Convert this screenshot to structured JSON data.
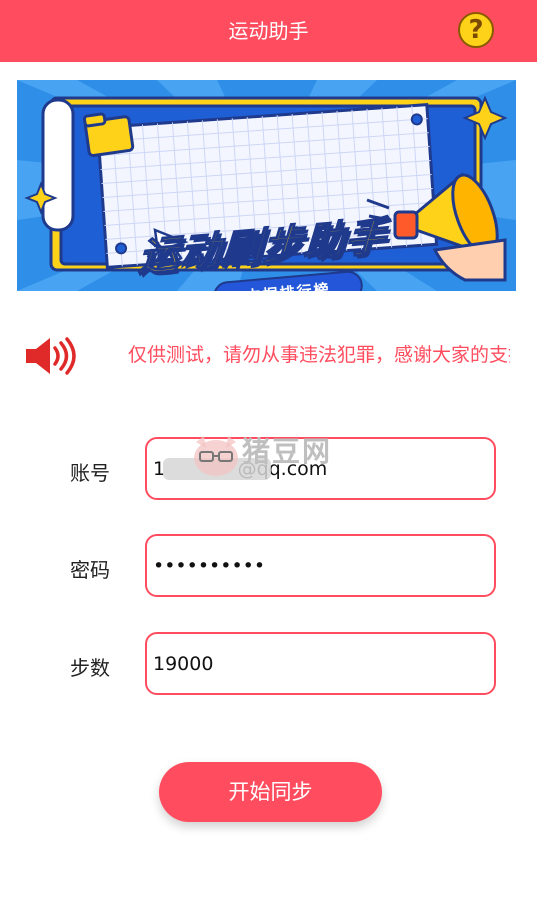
{
  "header": {
    "title": "运动助手",
    "help_icon": "question-mark-icon",
    "help_glyph": "?"
  },
  "banner": {
    "title": "运动刷步助手",
    "subtitle": "占据排行榜",
    "colors": {
      "background": "#2f8fe8",
      "title": "#ffd21a",
      "accent": "#2356d8"
    }
  },
  "notice": {
    "icon": "speaker-icon",
    "text": "仅供测试，请勿从事违法犯罪，感谢大家的支持"
  },
  "form": {
    "account": {
      "label": "账号",
      "value": "1            @qq.com"
    },
    "password": {
      "label": "密码",
      "value": "••••••••••"
    },
    "steps": {
      "label": "步数",
      "value": "19000"
    }
  },
  "watermark": {
    "text": "猪豆网"
  },
  "actions": {
    "sync_label": "开始同步"
  },
  "theme": {
    "primary": "#ff4d5f"
  }
}
